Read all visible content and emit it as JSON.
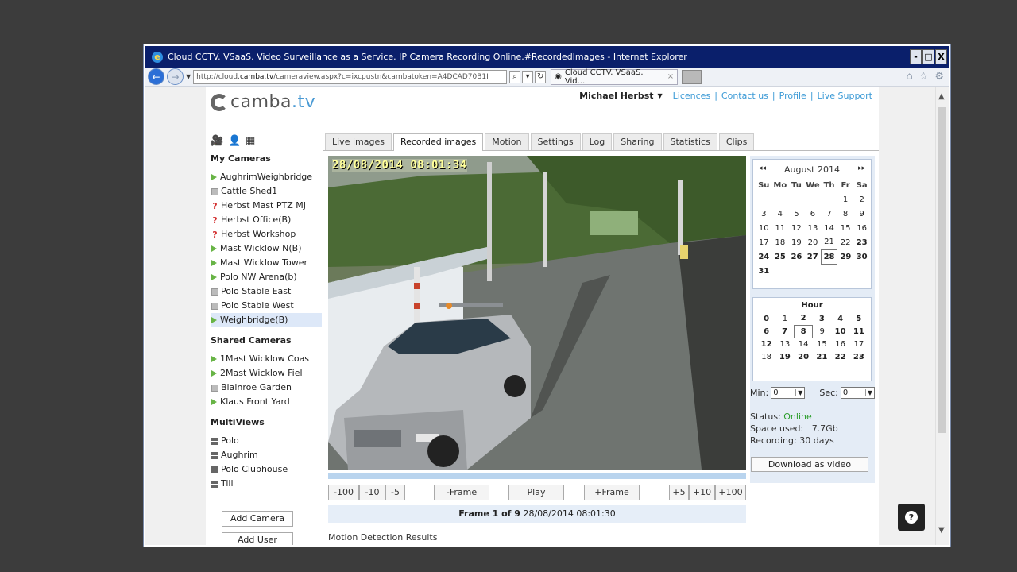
{
  "window": {
    "title": "Cloud CCTV. VSaaS. Video Surveillance as a Service. IP Camera Recording Online.#RecordedImages - Internet Explorer",
    "controls": [
      "-",
      "□",
      "X"
    ]
  },
  "browser": {
    "url_prefix": "http://cloud.",
    "url_host": "camba.tv",
    "url_rest": "/cameraview.aspx?c=ixcpustn&cambatoken=A4DCAD70B1I",
    "tab_title": "Cloud CCTV. VSaaS. Vid...",
    "tab_close": "×"
  },
  "header": {
    "logo_text": "camba",
    "logo_tld": ".tv",
    "user": "Michael Herbst",
    "user_caret": "▼",
    "links": [
      "Licences",
      "Contact us",
      "Profile",
      "Live Support"
    ],
    "separator": "|"
  },
  "sidebar": {
    "my_cameras_title": "My Cameras",
    "my_cameras": [
      {
        "name": "AughrimWeighbridge",
        "status": "play"
      },
      {
        "name": "Cattle Shed1",
        "status": "stop"
      },
      {
        "name": "Herbst Mast PTZ MJ",
        "status": "err"
      },
      {
        "name": "Herbst Office(B)",
        "status": "err"
      },
      {
        "name": "Herbst Workshop",
        "status": "err"
      },
      {
        "name": "Mast Wicklow N(B)",
        "status": "play"
      },
      {
        "name": "Mast Wicklow Tower",
        "status": "play"
      },
      {
        "name": "Polo NW Arena(b)",
        "status": "play"
      },
      {
        "name": "Polo Stable East",
        "status": "stop"
      },
      {
        "name": "Polo Stable West",
        "status": "stop"
      },
      {
        "name": "Weighbridge(B)",
        "status": "play"
      }
    ],
    "shared_cameras_title": "Shared Cameras",
    "shared_cameras": [
      {
        "name": "1Mast Wicklow Coas",
        "status": "play"
      },
      {
        "name": "2Mast Wicklow Fiel",
        "status": "play"
      },
      {
        "name": "Blainroe Garden",
        "status": "stop"
      },
      {
        "name": "Klaus Front Yard",
        "status": "play"
      }
    ],
    "multiviews_title": "MultiViews",
    "multiviews": [
      "Polo",
      "Aughrim",
      "Polo Clubhouse",
      "Till"
    ],
    "add_camera": "Add Camera",
    "add_user": "Add User"
  },
  "tabs": [
    "Live images",
    "Recorded images",
    "Motion",
    "Settings",
    "Log",
    "Sharing",
    "Statistics",
    "Clips"
  ],
  "active_tab": "Recorded images",
  "player": {
    "timestamp": "28/08/2014 08:01:34",
    "controls": {
      "m100": "-100",
      "m10": "-10",
      "m5": "-5",
      "prev_frame": "-Frame",
      "play": "Play",
      "next_frame": "+Frame",
      "p5": "+5",
      "p10": "+10",
      "p100": "+100"
    },
    "frame_label": "Frame 1 of 9",
    "frame_time": "28/08/2014 08:01:30",
    "motion_title": "Motion Detection Results"
  },
  "calendar": {
    "prev": "◂◂",
    "next": "▸▸",
    "month": "August 2014",
    "weekdays": [
      "Su",
      "Mo",
      "Tu",
      "We",
      "Th",
      "Fr",
      "Sa"
    ],
    "weeks": [
      [
        "",
        "",
        "",
        "",
        "",
        "1",
        "2"
      ],
      [
        "3",
        "4",
        "5",
        "6",
        "7",
        "8",
        "9"
      ],
      [
        "10",
        "11",
        "12",
        "13",
        "14",
        "15",
        "16"
      ],
      [
        "17",
        "18",
        "19",
        "20",
        "21",
        "22",
        "23"
      ],
      [
        "24",
        "25",
        "26",
        "27",
        "28",
        "29",
        "30"
      ],
      [
        "31",
        "",
        "",
        "",
        "",
        "",
        ""
      ]
    ],
    "bold_days": [
      "23",
      "24",
      "25",
      "26",
      "27",
      "28",
      "29",
      "30",
      "31"
    ],
    "selected_day": "28"
  },
  "hours": {
    "title": "Hour",
    "rows": [
      [
        "0",
        "1",
        "2",
        "3",
        "4",
        "5"
      ],
      [
        "6",
        "7",
        "8",
        "9",
        "10",
        "11"
      ],
      [
        "12",
        "13",
        "14",
        "15",
        "16",
        "17"
      ],
      [
        "18",
        "19",
        "20",
        "21",
        "22",
        "23"
      ]
    ],
    "bold_hours": [
      "0",
      "2",
      "3",
      "4",
      "5",
      "6",
      "7",
      "8",
      "10",
      "11",
      "12",
      "19",
      "20",
      "21",
      "22",
      "23"
    ],
    "selected_hour": "8"
  },
  "time_select": {
    "min_label": "Min:",
    "min_value": "0",
    "sec_label": "Sec:",
    "sec_value": "0"
  },
  "status": {
    "status_label": "Status:",
    "status_value": "Online",
    "space_label": "Space used:",
    "space_value": "7.7Gb",
    "recording_label": "Recording:",
    "recording_value": "30 days",
    "download_button": "Download as video"
  },
  "help": {
    "glyph": "?"
  },
  "colors": {
    "title_bar": "#0a1f6b",
    "link": "#3b9ad6",
    "online": "#2a9d2a",
    "accent_panel": "#e4ecf6"
  }
}
